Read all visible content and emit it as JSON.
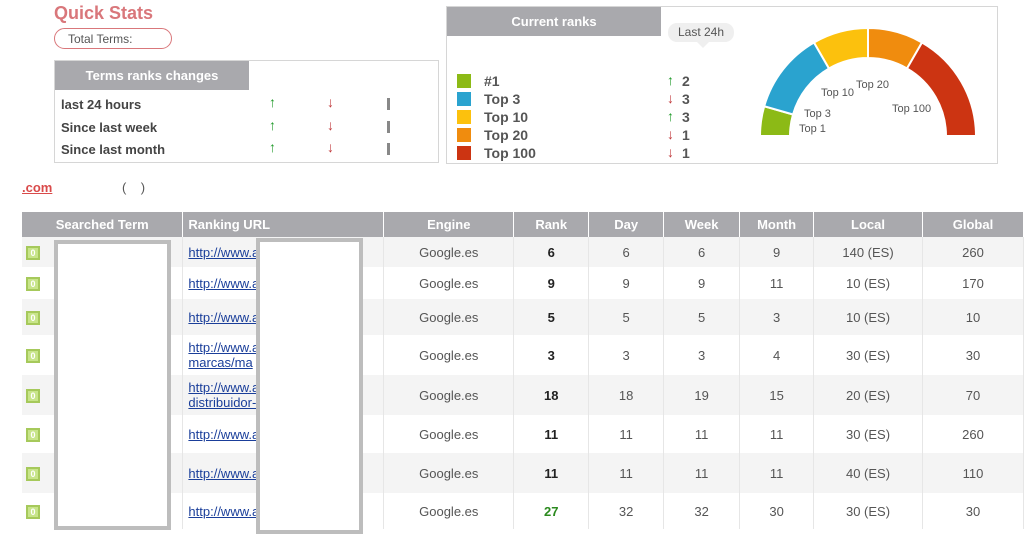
{
  "quick_stats": {
    "title": "Quick Stats",
    "total_terms_label": "Total Terms:"
  },
  "trc": {
    "title": "Terms ranks changes",
    "rows": [
      {
        "label": "last 24 hours"
      },
      {
        "label": "Since last week"
      },
      {
        "label": "Since last month"
      }
    ],
    "up_icon": "↑",
    "down_icon": "↓"
  },
  "current_ranks": {
    "title": "Current ranks",
    "badge": "Last 24h",
    "legend": [
      {
        "label": "#1",
        "color": "#8cba16",
        "dir": "↑",
        "value": "2"
      },
      {
        "label": "Top 3",
        "color": "#2aa3cf",
        "dir": "↓",
        "value": "3"
      },
      {
        "label": "Top 10",
        "color": "#fcc10d",
        "dir": "↑",
        "value": "3"
      },
      {
        "label": "Top 20",
        "color": "#f08c0e",
        "dir": "↓",
        "value": "1"
      },
      {
        "label": "Top 100",
        "color": "#cc3412",
        "dir": "↓",
        "value": "1"
      }
    ],
    "gauge_labels": [
      "Top 1",
      "Top 3",
      "Top 10",
      "Top 20",
      "Top 100"
    ]
  },
  "domain": {
    "text": ".com",
    "paren_open": "(",
    "paren_close": ")"
  },
  "table": {
    "headers": [
      "Searched Term",
      "Ranking URL",
      "Engine",
      "Rank",
      "Day",
      "Week",
      "Month",
      "Local",
      "Global"
    ],
    "badge_text": "0",
    "rows": [
      {
        "url": [
          "http://www.a"
        ],
        "engine": "Google.es",
        "rank": "6",
        "day": "6",
        "week": "6",
        "month": "9",
        "local": "140 (ES)",
        "global": "260"
      },
      {
        "url": [
          "http://www.a"
        ],
        "engine": "Google.es",
        "rank": "9",
        "day": "9",
        "week": "9",
        "month": "11",
        "local": "10 (ES)",
        "global": "170"
      },
      {
        "url": [
          "http://www.a"
        ],
        "engine": "Google.es",
        "rank": "5",
        "day": "5",
        "week": "5",
        "month": "3",
        "local": "10 (ES)",
        "global": "10"
      },
      {
        "url": [
          "http://www.a",
          "marcas/ma"
        ],
        "engine": "Google.es",
        "rank": "3",
        "day": "3",
        "week": "3",
        "month": "4",
        "local": "30 (ES)",
        "global": "30"
      },
      {
        "url": [
          "http://www.a",
          "distribuidor-"
        ],
        "engine": "Google.es",
        "rank": "18",
        "day": "18",
        "week": "19",
        "month": "15",
        "local": "20 (ES)",
        "global": "70"
      },
      {
        "url": [
          "http://www.a"
        ],
        "engine": "Google.es",
        "rank": "11",
        "day": "11",
        "week": "11",
        "month": "11",
        "local": "30 (ES)",
        "global": "260"
      },
      {
        "url": [
          "http://www.a"
        ],
        "engine": "Google.es",
        "rank": "11",
        "day": "11",
        "week": "11",
        "month": "11",
        "local": "40 (ES)",
        "global": "110"
      },
      {
        "url": [
          "http://www.a"
        ],
        "engine": "Google.es",
        "rank": "27",
        "day": "32",
        "week": "32",
        "month": "30",
        "local": "30 (ES)",
        "global": "30",
        "rank_color": "green"
      }
    ]
  }
}
